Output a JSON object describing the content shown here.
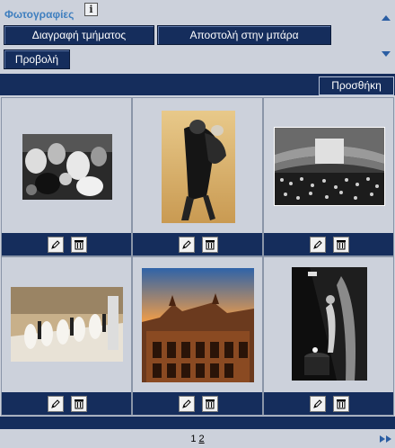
{
  "header": {
    "title": "Φωτογραφίες",
    "info_label": "i",
    "delete_section_label": "Διαγραφή τμήματος",
    "send_to_bar_label": "Αποστολή στην μπάρα",
    "view_label": "Προβολή",
    "scroll_up_icon": "triangle-up-icon",
    "scroll_down_icon": "triangle-down-icon"
  },
  "toolbar": {
    "add_label": "Προσθήκη"
  },
  "photos": [
    {
      "subject": "ballroom-dancers-bw",
      "edit_icon": "pencil-icon",
      "delete_icon": "trash-icon"
    },
    {
      "subject": "dancing-couple-blurred",
      "edit_icon": "pencil-icon",
      "delete_icon": "trash-icon"
    },
    {
      "subject": "opera-hall-audience-bw",
      "edit_icon": "pencil-icon",
      "delete_icon": "trash-icon"
    },
    {
      "subject": "debutantes-on-staircase",
      "edit_icon": "pencil-icon",
      "delete_icon": "trash-icon"
    },
    {
      "subject": "opera-house-facade-sunset",
      "edit_icon": "pencil-icon",
      "delete_icon": "trash-icon"
    },
    {
      "subject": "silhouette-dark-doorway",
      "edit_icon": "pencil-icon",
      "delete_icon": "trash-icon"
    }
  ],
  "pager": {
    "current_page": "1",
    "next_page": "2",
    "last_icon": "fast-forward-icon"
  },
  "colors": {
    "navy": "#152d5c",
    "panel": "#ccd1db",
    "title_blue": "#3f7fbf",
    "arrow_blue": "#2b5ea3"
  }
}
